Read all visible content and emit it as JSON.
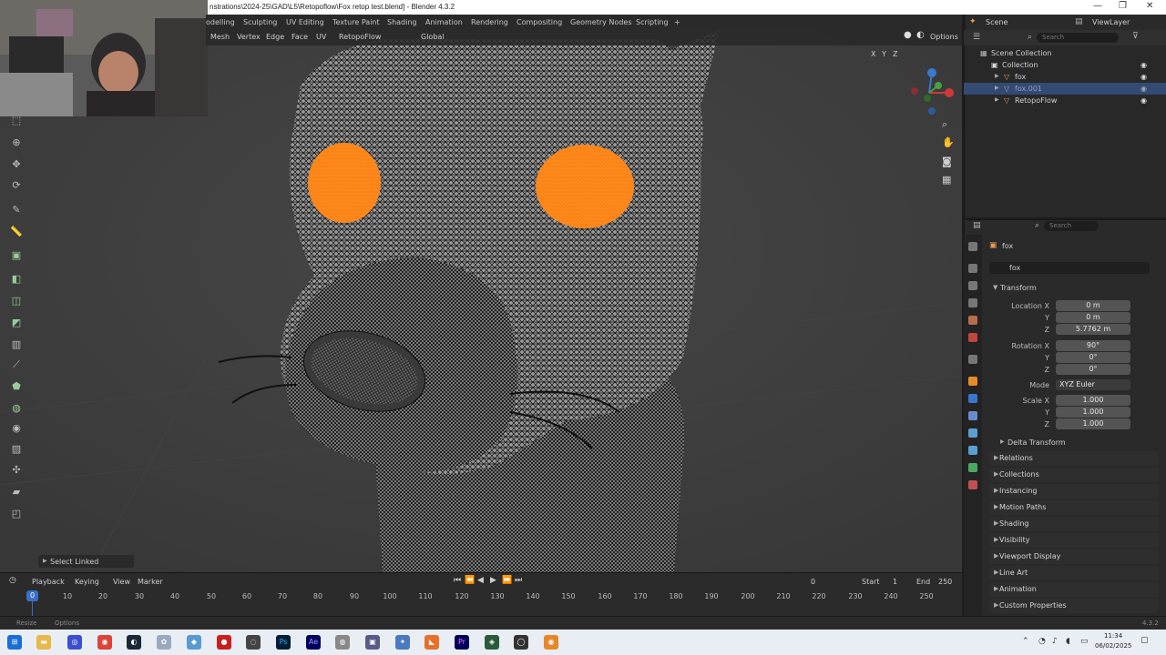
{
  "window": {
    "title": "nstrations\\2024-25\\GAD\\L5\\Retopoflow\\Fox retop test.blend] - Blender 4.3.2",
    "controls": [
      "—",
      "❐",
      "✕"
    ]
  },
  "workspace_tabs": [
    "odelling",
    "Sculpting",
    "UV Editing",
    "Texture Paint",
    "Shading",
    "Animation",
    "Rendering",
    "Compositing",
    "Geometry Nodes",
    "Scripting",
    "+"
  ],
  "top_right": {
    "scene": "Scene",
    "view_layer": "ViewLayer"
  },
  "viewport_header": {
    "menus": [
      "Mesh",
      "Vertex",
      "Edge",
      "Face",
      "UV"
    ],
    "retopoflow": "RetopoFlow",
    "orientation": "Global",
    "options": "Options",
    "axes": [
      "X",
      "Y",
      "Z"
    ]
  },
  "toolbar_tools": [
    "select-icon",
    "cursor-icon",
    "move-icon",
    "rotate-icon",
    "scale-icon",
    "transform-icon",
    "annotate-icon",
    "measure-icon",
    "add-cube-icon",
    "extrude-icon",
    "inset-icon",
    "bevel-icon",
    "loop-cut-icon",
    "knife-icon",
    "poly-build-icon",
    "spin-icon",
    "smooth-icon",
    "edge-slide-icon",
    "shrink-icon",
    "shear-icon",
    "rip-icon"
  ],
  "last_operator": "Select Linked",
  "timeline": {
    "menus": [
      "Playback",
      "Keying",
      "View",
      "Marker"
    ],
    "current_frame": "0",
    "start_label": "Start",
    "start": "1",
    "end_label": "End",
    "end": "250",
    "playhead": "0",
    "ticks": [
      "10",
      "20",
      "30",
      "40",
      "50",
      "60",
      "70",
      "80",
      "90",
      "100",
      "110",
      "120",
      "130",
      "140",
      "150",
      "160",
      "170",
      "180",
      "190",
      "200",
      "210",
      "220",
      "230",
      "240",
      "250"
    ]
  },
  "statusbar": {
    "left": "Resize",
    "options": "Options",
    "version": "4.3.2"
  },
  "outliner": {
    "search_placeholder": "Search",
    "root": "Scene Collection",
    "collection": "Collection",
    "items": [
      "fox",
      "fox.001",
      "RetopoFlow"
    ]
  },
  "properties": {
    "search_placeholder": "Search",
    "object_name": "fox",
    "object_field": "fox",
    "transform": "Transform",
    "location_label": "Location X",
    "location": [
      "0 m",
      "0 m",
      "5.7762 m"
    ],
    "rotation_label": "Rotation X",
    "rotation": [
      "90°",
      "0°",
      "0°"
    ],
    "mode_label": "Mode",
    "mode": "XYZ Euler",
    "scale_label": "Scale X",
    "scale": [
      "1.000",
      "1.000",
      "1.000"
    ],
    "y": "Y",
    "z": "Z",
    "delta": "Delta Transform",
    "sections": [
      "Relations",
      "Collections",
      "Instancing",
      "Motion Paths",
      "Shading",
      "Visibility",
      "Viewport Display",
      "Line Art",
      "Animation",
      "Custom Properties"
    ]
  },
  "taskbar": {
    "time": "11:34",
    "date": "06/02/2025"
  },
  "colors": {
    "accent_orange": "#ff8a1c",
    "selection_blue": "#3a5a9a",
    "viewport_bg": "#3d3d3d"
  }
}
